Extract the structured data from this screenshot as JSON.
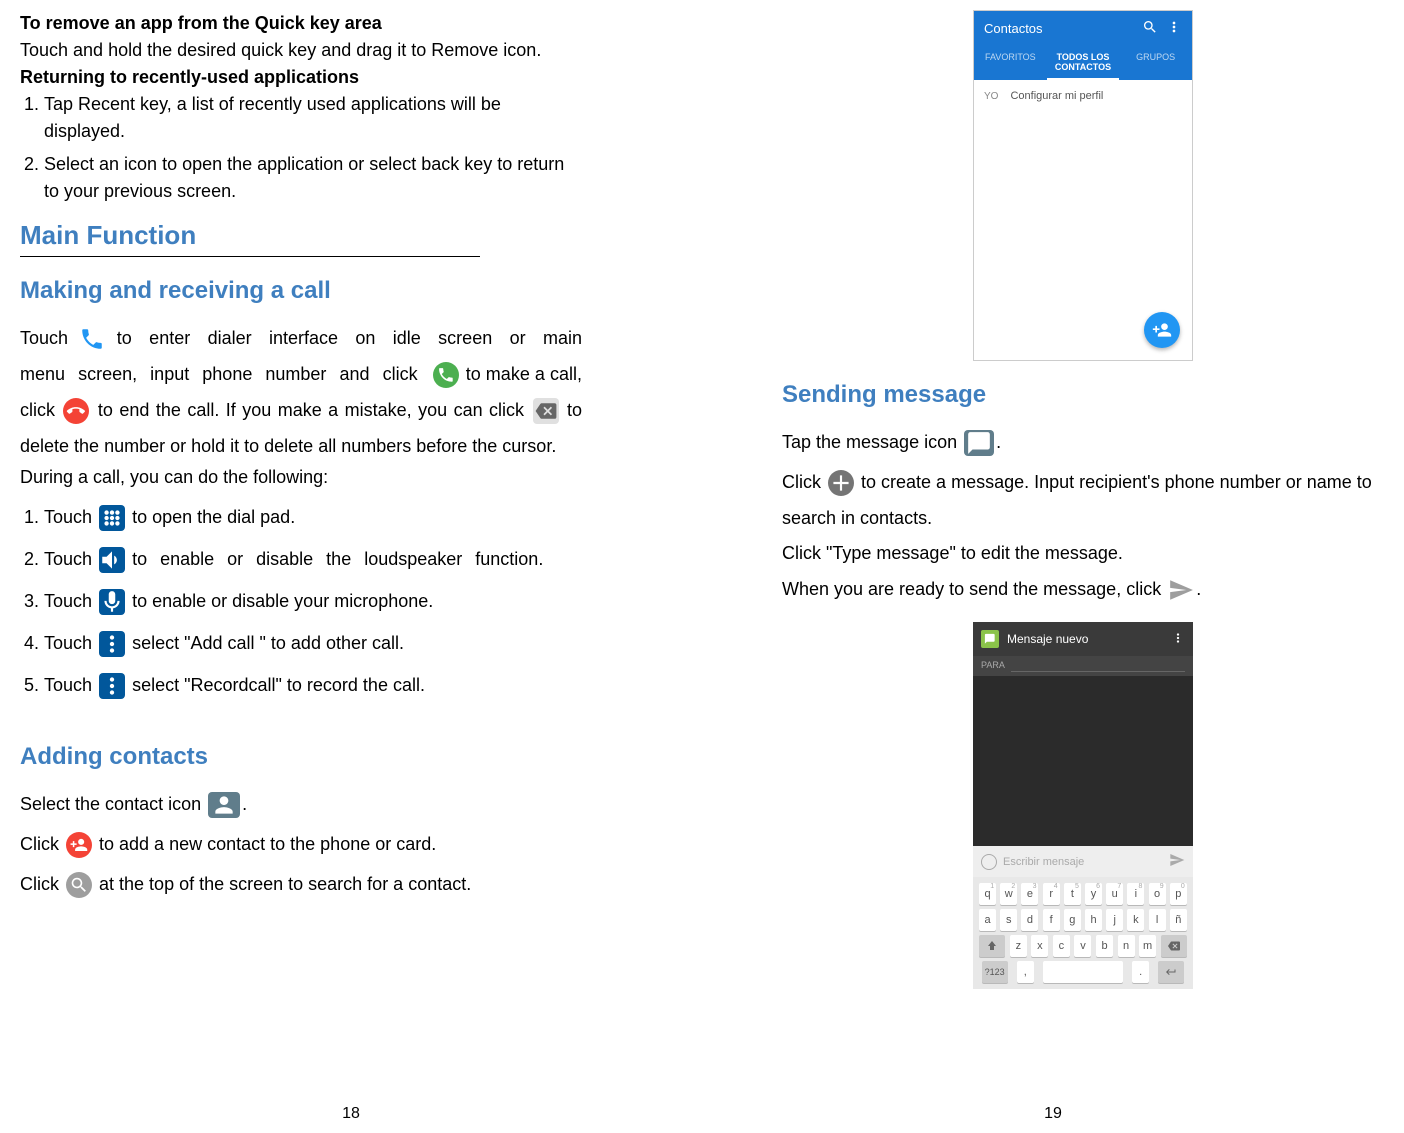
{
  "left": {
    "h_remove": "To remove an app from the Quick key area",
    "p_remove": "Touch and hold the desired quick key and drag it to Remove icon.",
    "h_return": "Returning to recently-used applications",
    "ol_return": [
      "Tap Recent key, a list of recently used applications will be displayed.",
      "Select an icon to open the application or select back key to return to your previous screen."
    ],
    "h_main": "Main Function",
    "h_making": "Making and receiving a call",
    "p_call_1a": "Touch ",
    "p_call_1b": " to enter dialer interface on idle screen or main menu screen, input phone number and click ",
    "p_call_2a": "to make a call, click ",
    "p_call_2b": " to end the call. If you make a mistake, you can click ",
    "p_call_2c": " to delete the number or hold it to delete all numbers before the cursor.",
    "p_during": "During a call, you can do the following:",
    "ol_call": [
      {
        "pre": "Touch ",
        "post": " to open the dial pad."
      },
      {
        "pre": "Touch ",
        "post": " to enable or disable the loudspeaker function."
      },
      {
        "pre": "Touch ",
        "post": " to enable or disable your microphone."
      },
      {
        "pre": "Touch ",
        "post": " select \"Add call \" to add other call."
      },
      {
        "pre": "Touch ",
        "post": " select \"Recordcall\" to record the call."
      }
    ],
    "h_adding": "Adding contacts",
    "p_add_1a": "Select the contact icon ",
    "p_add_2a": "Click ",
    "p_add_2b": " to add a new contact to the phone or card.",
    "p_add_3a": "Click ",
    "p_add_3b": " at the top of the screen to search for a contact.",
    "page_number": "18"
  },
  "right": {
    "contacts_shot": {
      "title": "Contactos",
      "tabs": [
        "FAVORITOS",
        "TODOS LOS CONTACTOS",
        "GRUPOS"
      ],
      "row_avatar": "YO",
      "row_text": "Configurar mi perfil"
    },
    "h_sending": "Sending message",
    "p_msg_1a": "Tap the message icon",
    "p_msg_2a": "Click ",
    "p_msg_2b": " to create a message. Input recipient's phone number or name to search in contacts.",
    "p_msg_3": "Click \"Type message\" to edit the message.",
    "p_msg_4a": "When you are ready to send the message, click ",
    "message_shot": {
      "title": "Mensaje nuevo",
      "para_label": "PARA",
      "input_placeholder": "Escribir mensaje",
      "kb_row1": [
        {
          "k": "q",
          "n": "1"
        },
        {
          "k": "w",
          "n": "2"
        },
        {
          "k": "e",
          "n": "3"
        },
        {
          "k": "r",
          "n": "4"
        },
        {
          "k": "t",
          "n": "5"
        },
        {
          "k": "y",
          "n": "6"
        },
        {
          "k": "u",
          "n": "7"
        },
        {
          "k": "i",
          "n": "8"
        },
        {
          "k": "o",
          "n": "9"
        },
        {
          "k": "p",
          "n": "0"
        }
      ],
      "kb_row2": [
        "a",
        "s",
        "d",
        "f",
        "g",
        "h",
        "j",
        "k",
        "l",
        "ñ"
      ],
      "kb_row3": [
        "z",
        "x",
        "c",
        "v",
        "b",
        "n",
        "m"
      ],
      "kb_sym": "?123",
      "kb_comma": ",",
      "kb_period": "."
    },
    "page_number": "19"
  }
}
